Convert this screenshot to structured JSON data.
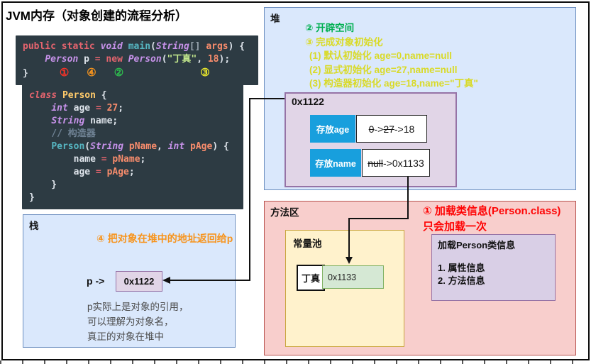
{
  "title": "JVM内存（对象创建的流程分析）",
  "colors": {
    "heap_fill": "#dae8fc",
    "heap_border": "#6c8ebf",
    "method_fill": "#f8cecc",
    "method_border": "#b85450",
    "object_fill": "#e1d5e7",
    "object_border": "#9673a6",
    "slot_label_fill": "#189fdd",
    "pool_fill": "#fff2cc",
    "pool_value_fill": "#d5e8d4",
    "step_green": "#00af50",
    "step_yellow": "#d9da28",
    "step_red": "#fe0505",
    "step_orange": "#f7941d",
    "code_bg": "#2d3b43"
  },
  "code_blocks": [
    {
      "id": "code-main",
      "lines": [
        [
          {
            "t": "public static ",
            "c": "kw"
          },
          {
            "t": "void ",
            "c": "ty"
          },
          {
            "t": "main",
            "c": "fn"
          },
          {
            "t": "(",
            "c": "pl"
          },
          {
            "t": "String",
            "c": "ty"
          },
          {
            "t": "[] ",
            "c": "br"
          },
          {
            "t": "args",
            "c": "pa"
          },
          {
            "t": ") {",
            "c": "pl"
          }
        ],
        [
          {
            "t": "    ",
            "c": "pl"
          },
          {
            "t": "Person ",
            "c": "ty"
          },
          {
            "t": "p ",
            "c": "pl"
          },
          {
            "t": "= ",
            "c": "kw"
          },
          {
            "t": "new ",
            "c": "kw"
          },
          {
            "t": "Person",
            "c": "ty"
          },
          {
            "t": "(",
            "c": "pl"
          },
          {
            "t": "\"丁真\"",
            "c": "st"
          },
          {
            "t": ", ",
            "c": "pl"
          },
          {
            "t": "18",
            "c": "nu"
          },
          {
            "t": ");",
            "c": "pl"
          }
        ],
        [
          {
            "t": "}",
            "c": "pl"
          },
          {
            "t": "①",
            "c": "mk mk-red"
          },
          {
            "t": "④",
            "c": "mk mk-or"
          },
          {
            "t": "②",
            "c": "mk mk-gr"
          },
          {
            "t": "③",
            "c": "mk mk-ye"
          }
        ]
      ]
    },
    {
      "id": "code-person",
      "lines": [
        [
          {
            "t": "class ",
            "c": "kwi"
          },
          {
            "t": "Person ",
            "c": "cn"
          },
          {
            "t": "{",
            "c": "pl"
          }
        ],
        [
          {
            "t": "    ",
            "c": "pl"
          },
          {
            "t": "int ",
            "c": "ty"
          },
          {
            "t": "age ",
            "c": "pl"
          },
          {
            "t": "= ",
            "c": "kw"
          },
          {
            "t": "27",
            "c": "nu"
          },
          {
            "t": ";",
            "c": "pl"
          }
        ],
        [
          {
            "t": "    ",
            "c": "pl"
          },
          {
            "t": "String ",
            "c": "ty"
          },
          {
            "t": "name",
            "c": "pl"
          },
          {
            "t": ";",
            "c": "pl"
          }
        ],
        [
          {
            "t": "    // 构造器",
            "c": "cm"
          }
        ],
        [
          {
            "t": "    ",
            "c": "pl"
          },
          {
            "t": "Person",
            "c": "fn"
          },
          {
            "t": "(",
            "c": "pl"
          },
          {
            "t": "String ",
            "c": "ty"
          },
          {
            "t": "pName",
            "c": "pa"
          },
          {
            "t": ", ",
            "c": "pl"
          },
          {
            "t": "int ",
            "c": "ty"
          },
          {
            "t": "pAge",
            "c": "pa"
          },
          {
            "t": ") {",
            "c": "pl"
          }
        ],
        [
          {
            "t": "        name ",
            "c": "pl"
          },
          {
            "t": "= ",
            "c": "kw"
          },
          {
            "t": "pName",
            "c": "pa"
          },
          {
            "t": ";",
            "c": "pl"
          }
        ],
        [
          {
            "t": "        age ",
            "c": "pl"
          },
          {
            "t": "= ",
            "c": "kw"
          },
          {
            "t": "pAge",
            "c": "pa"
          },
          {
            "t": ";",
            "c": "pl"
          }
        ],
        [
          {
            "t": "    }",
            "c": "pl"
          }
        ],
        [
          {
            "t": "}",
            "c": "pl"
          }
        ]
      ]
    }
  ],
  "heap": {
    "label": "堆",
    "step2": "② 开辟空间",
    "step3": "③ 完成对象初始化",
    "sub1": "(1) 默认初始化 age=0,name=null",
    "sub2": "(2) 显式初始化 age=27,name=null",
    "sub3": "(3) 构造器初始化 age=18,name=\"丁真\"",
    "object": {
      "address": "0x1122",
      "age_row": {
        "label": "存放age",
        "v1": "0",
        "arrow1": "->",
        "v2": "27",
        "arrow2": "->",
        "v3": "18"
      },
      "name_row": {
        "label": "存放name",
        "v1": "null",
        "arrow": "->",
        "v2": "0x1133"
      }
    }
  },
  "stack": {
    "label": "栈",
    "step4": "④ 把对象在堆中的地址返回给p",
    "pointer_label": "p ->",
    "address": "0x1122",
    "note": [
      "p实际上是对象的引用，",
      "可以理解为对象名，",
      "真正的对象在堆中"
    ]
  },
  "method_area": {
    "label": "方法区",
    "step1_line1": "① 加载类信息(Person.class)",
    "step1_line2": "只会加载一次",
    "constant_pool": {
      "label": "常量池",
      "key": "丁真",
      "value": "0x1133"
    },
    "class_info": {
      "title": "加载Person类信息",
      "items": [
        "1. 属性信息",
        "2. 方法信息"
      ]
    }
  }
}
